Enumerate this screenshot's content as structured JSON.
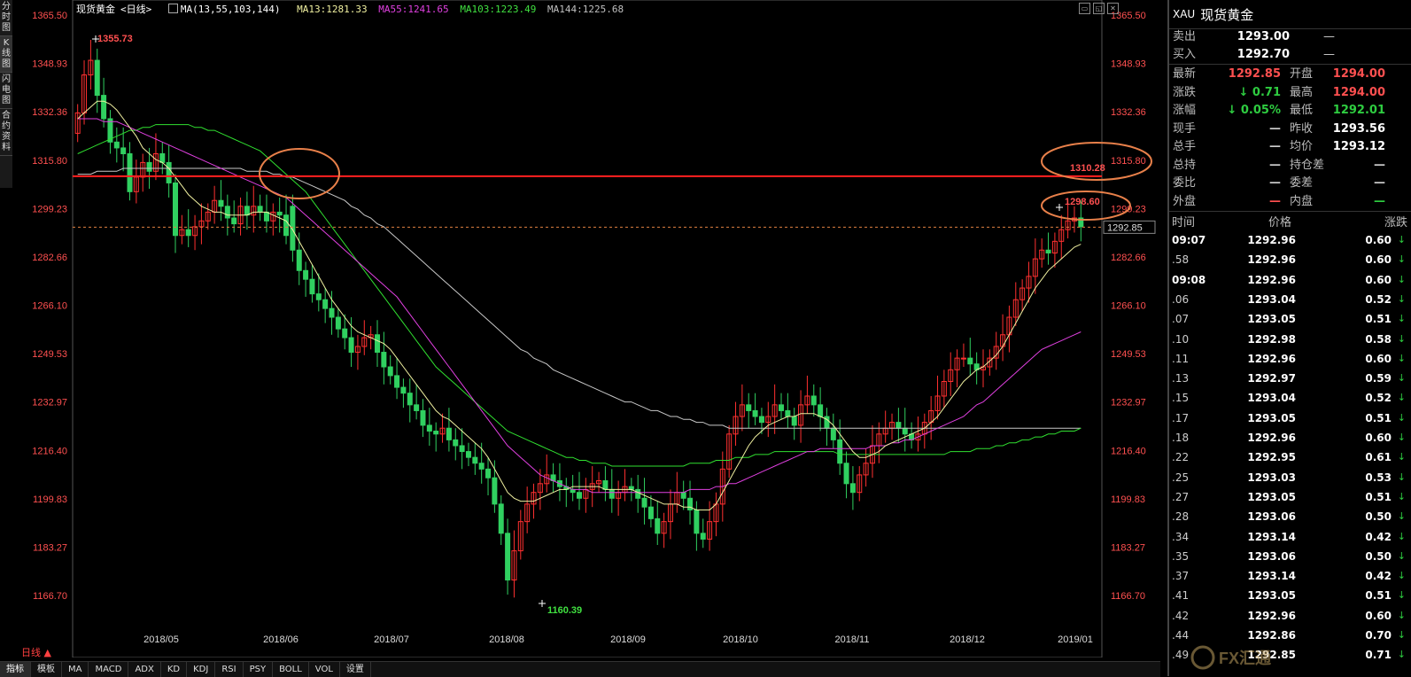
{
  "left_tabs": [
    "分时图",
    "K线图",
    "闪电图",
    "合约资料"
  ],
  "header": {
    "symbol_name": "现货黄金",
    "period": "<日线>",
    "ma_params": "MA(13,55,103,144)",
    "ma13": "MA13:1281.33",
    "ma55": "MA55:1241.65",
    "ma103": "MA103:1223.49",
    "ma144": "MA144:1225.68"
  },
  "window_icons": [
    "minimize-icon",
    "restore-icon",
    "close-icon"
  ],
  "axis": {
    "y_ticks": [
      "1365.50",
      "1348.93",
      "1332.36",
      "1315.80",
      "1299.23",
      "1282.66",
      "1266.10",
      "1249.53",
      "1232.97",
      "1216.40",
      "1199.83",
      "1183.27",
      "1166.70"
    ],
    "x_ticks": [
      "2018/05",
      "2018/06",
      "2018/07",
      "2018/08",
      "2018/09",
      "2018/10",
      "2018/11",
      "2018/12",
      "2019/01"
    ],
    "current_price_tag": "1292.85"
  },
  "annotations": {
    "high_label": "1355.73",
    "low_label": "1160.39",
    "resistance_label": "1310.28",
    "recent_high_label": "1298.60"
  },
  "chart_data": {
    "type": "candlestick",
    "ylim": [
      1160,
      1367
    ],
    "resistance": 1310.28,
    "current": 1292.85,
    "high_point": 1355.73,
    "low_point": 1160.39,
    "closes": [
      1332,
      1345,
      1350,
      1338,
      1330,
      1322,
      1320,
      1318,
      1305,
      1310,
      1315,
      1312,
      1318,
      1315,
      1308,
      1290,
      1292,
      1290,
      1293,
      1295,
      1298,
      1302,
      1300,
      1296,
      1294,
      1300,
      1297,
      1300,
      1298,
      1295,
      1298,
      1297,
      1290,
      1285,
      1278,
      1275,
      1270,
      1268,
      1265,
      1262,
      1258,
      1255,
      1250,
      1252,
      1255,
      1256,
      1250,
      1245,
      1242,
      1238,
      1236,
      1232,
      1230,
      1225,
      1223,
      1222,
      1224,
      1220,
      1218,
      1216,
      1214,
      1212,
      1210,
      1207,
      1198,
      1188,
      1172,
      1182,
      1192,
      1198,
      1202,
      1205,
      1208,
      1206,
      1204,
      1203,
      1202,
      1200,
      1203,
      1205,
      1206,
      1203,
      1200,
      1202,
      1204,
      1203,
      1200,
      1197,
      1193,
      1188,
      1192,
      1198,
      1202,
      1200,
      1196,
      1188,
      1186,
      1192,
      1198,
      1210,
      1222,
      1228,
      1232,
      1230,
      1228,
      1226,
      1228,
      1232,
      1230,
      1228,
      1225,
      1232,
      1235,
      1232,
      1228,
      1224,
      1220,
      1212,
      1205,
      1202,
      1208,
      1212,
      1218,
      1222,
      1224,
      1226,
      1224,
      1222,
      1220,
      1222,
      1226,
      1230,
      1235,
      1240,
      1244,
      1248,
      1248,
      1246,
      1244,
      1245,
      1248,
      1252,
      1256,
      1262,
      1268,
      1272,
      1276,
      1282,
      1285,
      1284,
      1288,
      1292,
      1295,
      1296,
      1293
    ],
    "opens": [
      1325,
      1332,
      1345,
      1350,
      1338,
      1330,
      1322,
      1320,
      1318,
      1305,
      1310,
      1315,
      1312,
      1318,
      1315,
      1308,
      1290,
      1292,
      1290,
      1293,
      1295,
      1298,
      1302,
      1300,
      1296,
      1294,
      1300,
      1297,
      1300,
      1298,
      1295,
      1298,
      1297,
      1300,
      1285,
      1278,
      1275,
      1270,
      1268,
      1265,
      1262,
      1258,
      1255,
      1250,
      1252,
      1255,
      1256,
      1250,
      1245,
      1242,
      1238,
      1236,
      1232,
      1230,
      1225,
      1223,
      1222,
      1224,
      1220,
      1218,
      1216,
      1214,
      1212,
      1210,
      1207,
      1198,
      1188,
      1172,
      1182,
      1192,
      1198,
      1202,
      1205,
      1208,
      1206,
      1204,
      1203,
      1202,
      1200,
      1203,
      1205,
      1206,
      1203,
      1200,
      1202,
      1204,
      1203,
      1200,
      1197,
      1193,
      1188,
      1192,
      1198,
      1202,
      1200,
      1196,
      1188,
      1186,
      1192,
      1198,
      1210,
      1222,
      1228,
      1232,
      1230,
      1228,
      1226,
      1228,
      1232,
      1230,
      1228,
      1225,
      1232,
      1235,
      1232,
      1228,
      1224,
      1220,
      1212,
      1205,
      1202,
      1208,
      1212,
      1218,
      1222,
      1224,
      1226,
      1224,
      1222,
      1220,
      1222,
      1226,
      1230,
      1235,
      1240,
      1244,
      1248,
      1248,
      1246,
      1244,
      1245,
      1248,
      1252,
      1256,
      1262,
      1268,
      1272,
      1276,
      1282,
      1285,
      1284,
      1288,
      1292,
      1295,
      1296
    ],
    "ma13": [
      1330,
      1332,
      1334,
      1336,
      1336,
      1335,
      1333,
      1330,
      1327,
      1324,
      1320,
      1318,
      1316,
      1315,
      1313,
      1310,
      1307,
      1304,
      1302,
      1300,
      1299,
      1298,
      1298,
      1297,
      1297,
      1297,
      1297,
      1298,
      1298,
      1298,
      1297,
      1296,
      1295,
      1292,
      1288,
      1284,
      1280,
      1276,
      1272,
      1268,
      1265,
      1262,
      1259,
      1257,
      1256,
      1255,
      1254,
      1253,
      1251,
      1248,
      1245,
      1242,
      1239,
      1236,
      1233,
      1230,
      1228,
      1227,
      1225,
      1223,
      1221,
      1219,
      1217,
      1214,
      1210,
      1206,
      1202,
      1200,
      1199,
      1199,
      1199,
      1200,
      1201,
      1202,
      1203,
      1203,
      1204,
      1204,
      1204,
      1204,
      1204,
      1203,
      1203,
      1203,
      1203,
      1203,
      1202,
      1201,
      1200,
      1199,
      1198,
      1198,
      1198,
      1197,
      1197,
      1196,
      1196,
      1196,
      1198,
      1202,
      1206,
      1210,
      1214,
      1218,
      1221,
      1223,
      1225,
      1226,
      1227,
      1228,
      1228,
      1229,
      1229,
      1229,
      1228,
      1227,
      1225,
      1222,
      1219,
      1216,
      1214,
      1214,
      1215,
      1216,
      1218,
      1219,
      1220,
      1221,
      1222,
      1223,
      1224,
      1226,
      1228,
      1231,
      1234,
      1237,
      1240,
      1242,
      1244,
      1245,
      1247,
      1249,
      1252,
      1256,
      1260,
      1264,
      1268,
      1272,
      1275,
      1278,
      1280,
      1282,
      1284,
      1286,
      1287
    ],
    "ma55": [
      1330,
      1330,
      1330,
      1330,
      1329,
      1329,
      1329,
      1328,
      1327,
      1326,
      1325,
      1324,
      1323,
      1322,
      1321,
      1320,
      1319,
      1318,
      1317,
      1316,
      1315,
      1314,
      1313,
      1312,
      1311,
      1310,
      1309,
      1308,
      1307,
      1306,
      1305,
      1304,
      1303,
      1301,
      1299,
      1297,
      1295,
      1293,
      1291,
      1289,
      1287,
      1285,
      1283,
      1281,
      1279,
      1277,
      1275,
      1273,
      1271,
      1269,
      1266,
      1263,
      1260,
      1257,
      1254,
      1251,
      1248,
      1245,
      1242,
      1239,
      1236,
      1233,
      1230,
      1227,
      1224,
      1221,
      1218,
      1216,
      1214,
      1212,
      1210,
      1208,
      1207,
      1206,
      1205,
      1204,
      1203,
      1203,
      1203,
      1202,
      1202,
      1202,
      1202,
      1202,
      1202,
      1202,
      1202,
      1202,
      1202,
      1202,
      1202,
      1202,
      1202,
      1202,
      1203,
      1203,
      1203,
      1203,
      1204,
      1204,
      1205,
      1205,
      1206,
      1207,
      1208,
      1209,
      1210,
      1211,
      1212,
      1213,
      1214,
      1215,
      1216,
      1216,
      1217,
      1217,
      1217,
      1217,
      1217,
      1217,
      1217,
      1217,
      1218,
      1218,
      1218,
      1219,
      1219,
      1220,
      1220,
      1221,
      1222,
      1223,
      1224,
      1225,
      1226,
      1227,
      1228,
      1230,
      1232,
      1233,
      1235,
      1237,
      1239,
      1241,
      1243,
      1245,
      1247,
      1249,
      1251,
      1252,
      1253,
      1254,
      1255,
      1256,
      1257
    ],
    "ma103": [
      1318,
      1319,
      1320,
      1321,
      1322,
      1323,
      1324,
      1325,
      1326,
      1326,
      1327,
      1327,
      1328,
      1328,
      1328,
      1328,
      1328,
      1328,
      1327,
      1327,
      1326,
      1326,
      1325,
      1324,
      1323,
      1322,
      1321,
      1320,
      1319,
      1317,
      1315,
      1313,
      1311,
      1309,
      1307,
      1305,
      1302,
      1299,
      1296,
      1293,
      1290,
      1287,
      1284,
      1281,
      1278,
      1275,
      1272,
      1269,
      1266,
      1263,
      1260,
      1257,
      1254,
      1251,
      1248,
      1245,
      1243,
      1241,
      1239,
      1237,
      1235,
      1233,
      1231,
      1229,
      1227,
      1225,
      1223,
      1222,
      1221,
      1220,
      1219,
      1218,
      1217,
      1216,
      1215,
      1214,
      1214,
      1213,
      1213,
      1212,
      1212,
      1212,
      1211,
      1211,
      1211,
      1211,
      1211,
      1211,
      1211,
      1211,
      1211,
      1211,
      1211,
      1211,
      1212,
      1212,
      1212,
      1212,
      1213,
      1213,
      1213,
      1214,
      1214,
      1214,
      1215,
      1215,
      1215,
      1216,
      1216,
      1216,
      1216,
      1216,
      1216,
      1216,
      1216,
      1216,
      1216,
      1215,
      1215,
      1215,
      1215,
      1215,
      1215,
      1215,
      1215,
      1215,
      1215,
      1215,
      1215,
      1215,
      1215,
      1215,
      1215,
      1215,
      1216,
      1216,
      1216,
      1216,
      1217,
      1217,
      1217,
      1218,
      1218,
      1219,
      1219,
      1220,
      1220,
      1221,
      1221,
      1222,
      1222,
      1223,
      1223,
      1223,
      1224
    ],
    "ma144": [
      1311,
      1311,
      1311,
      1312,
      1312,
      1312,
      1312,
      1313,
      1313,
      1313,
      1313,
      1313,
      1313,
      1313,
      1313,
      1313,
      1313,
      1313,
      1313,
      1313,
      1313,
      1313,
      1313,
      1313,
      1313,
      1313,
      1312,
      1312,
      1312,
      1312,
      1311,
      1311,
      1310,
      1310,
      1309,
      1308,
      1307,
      1306,
      1305,
      1304,
      1303,
      1302,
      1300,
      1299,
      1297,
      1296,
      1294,
      1293,
      1291,
      1289,
      1287,
      1285,
      1283,
      1281,
      1279,
      1277,
      1275,
      1273,
      1271,
      1269,
      1267,
      1265,
      1263,
      1261,
      1259,
      1257,
      1255,
      1253,
      1251,
      1250,
      1248,
      1247,
      1246,
      1244,
      1243,
      1242,
      1241,
      1240,
      1239,
      1238,
      1237,
      1236,
      1235,
      1234,
      1233,
      1233,
      1232,
      1231,
      1230,
      1230,
      1229,
      1228,
      1228,
      1227,
      1227,
      1226,
      1226,
      1225,
      1225,
      1225,
      1224,
      1224,
      1224,
      1224,
      1224,
      1224,
      1224,
      1224,
      1224,
      1224,
      1224,
      1224,
      1224,
      1224,
      1224,
      1224,
      1224,
      1224,
      1224,
      1224,
      1224,
      1224,
      1224,
      1224,
      1224,
      1224,
      1224,
      1224,
      1224,
      1224,
      1224,
      1224,
      1224,
      1224,
      1224,
      1224,
      1224,
      1224,
      1224,
      1224,
      1224,
      1224,
      1224,
      1224,
      1224,
      1224,
      1224,
      1224,
      1224,
      1224,
      1224,
      1224,
      1224,
      1224,
      1224
    ]
  },
  "right_panel": {
    "code": "XAU",
    "name": "现货黄金",
    "sell": {
      "label": "卖出",
      "value": "1293.00",
      "extra": "—"
    },
    "buy": {
      "label": "买入",
      "value": "1292.70",
      "extra": "—"
    },
    "quote_rows": [
      {
        "l1": "最新",
        "v1": "1292.85",
        "l2": "开盘",
        "v2": "1294.00",
        "c1": "#ff5050",
        "c2": "#ff5050"
      },
      {
        "l1": "涨跌",
        "v1": "↓ 0.71",
        "l2": "最高",
        "v2": "1294.00",
        "c1": "#2ecc40",
        "c2": "#ff5050"
      },
      {
        "l1": "涨幅",
        "v1": "↓ 0.05%",
        "l2": "最低",
        "v2": "1292.01",
        "c1": "#2ecc40",
        "c2": "#2ecc40"
      },
      {
        "l1": "现手",
        "v1": "—",
        "l2": "昨收",
        "v2": "1293.56",
        "c1": "#ccc",
        "c2": "#fff"
      },
      {
        "l1": "总手",
        "v1": "—",
        "l2": "均价",
        "v2": "1293.12",
        "c1": "#ccc",
        "c2": "#fff"
      },
      {
        "l1": "总持",
        "v1": "—",
        "l2": "持仓差",
        "v2": "—",
        "c1": "#ccc",
        "c2": "#ccc"
      },
      {
        "l1": "委比",
        "v1": "—",
        "l2": "委差",
        "v2": "—",
        "c1": "#ccc",
        "c2": "#ccc"
      },
      {
        "l1": "外盘",
        "v1": "—",
        "l2": "内盘",
        "v2": "—",
        "c1": "#ff5050",
        "c2": "#2ecc40"
      }
    ],
    "tick_header": [
      "时间",
      "价格",
      "涨跌"
    ],
    "ticks": [
      {
        "t": "09:07",
        "p": "1292.96",
        "c": "0.60",
        "bold": true
      },
      {
        "t": ".58",
        "p": "1292.96",
        "c": "0.60"
      },
      {
        "t": "09:08",
        "p": "1292.96",
        "c": "0.60",
        "bold": true
      },
      {
        "t": ".06",
        "p": "1293.04",
        "c": "0.52"
      },
      {
        "t": ".07",
        "p": "1293.05",
        "c": "0.51"
      },
      {
        "t": ".10",
        "p": "1292.98",
        "c": "0.58"
      },
      {
        "t": ".11",
        "p": "1292.96",
        "c": "0.60"
      },
      {
        "t": ".13",
        "p": "1292.97",
        "c": "0.59"
      },
      {
        "t": ".15",
        "p": "1293.04",
        "c": "0.52"
      },
      {
        "t": ".17",
        "p": "1293.05",
        "c": "0.51"
      },
      {
        "t": ".18",
        "p": "1292.96",
        "c": "0.60"
      },
      {
        "t": ".22",
        "p": "1292.95",
        "c": "0.61"
      },
      {
        "t": ".25",
        "p": "1293.03",
        "c": "0.53"
      },
      {
        "t": ".27",
        "p": "1293.05",
        "c": "0.51"
      },
      {
        "t": ".28",
        "p": "1293.06",
        "c": "0.50"
      },
      {
        "t": ".34",
        "p": "1293.14",
        "c": "0.42"
      },
      {
        "t": ".35",
        "p": "1293.06",
        "c": "0.50"
      },
      {
        "t": ".37",
        "p": "1293.14",
        "c": "0.42"
      },
      {
        "t": ".41",
        "p": "1293.05",
        "c": "0.51"
      },
      {
        "t": ".42",
        "p": "1292.96",
        "c": "0.60"
      },
      {
        "t": ".44",
        "p": "1292.86",
        "c": "0.70"
      },
      {
        "t": ".49",
        "p": "1292.85",
        "c": "0.71"
      }
    ]
  },
  "bottom_tabs": [
    "指标",
    "模板",
    "MA",
    "MACD",
    "ADX",
    "KD",
    "KDJ",
    "RSI",
    "PSY",
    "BOLL",
    "VOL",
    "设置"
  ],
  "period_label": "日线 ▲",
  "watermark": "FX汇通"
}
